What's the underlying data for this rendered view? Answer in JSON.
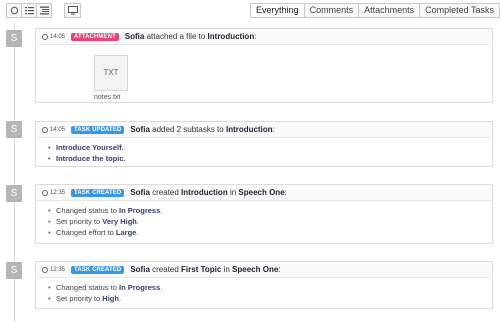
{
  "toolbar": {
    "icons": [
      "circle-view-icon",
      "list-view-icon",
      "detail-view-icon",
      "monitor-icon"
    ]
  },
  "tabs": [
    {
      "label": "Everything",
      "active": true
    },
    {
      "label": "Comments",
      "active": false
    },
    {
      "label": "Attachments",
      "active": false
    },
    {
      "label": "Completed Tasks",
      "active": false
    }
  ],
  "entries": [
    {
      "avatar": "S",
      "time": "14:05",
      "badge": "ATTACHMENT",
      "user": "Sofia",
      "action": "attached a file to",
      "target": "Introduction",
      "suffix": ":",
      "file": {
        "type": "TXT",
        "name": "notes.txt"
      }
    },
    {
      "avatar": "S",
      "time": "14:05",
      "badge": "TASK UPDATED",
      "user": "Sofia",
      "action": "added 2 subtasks to",
      "target": "Introduction",
      "suffix": ":",
      "items": [
        "Introduce Yourself.",
        "Introduce the topic."
      ]
    },
    {
      "avatar": "S",
      "time": "12:35",
      "badge": "TASK CREATED",
      "user": "Sofia",
      "action": "created",
      "target": "Introduction",
      "in": "in",
      "project": "Speech One",
      "suffix": ":",
      "changes": [
        {
          "pre": "Changed status to",
          "value": "In Progress"
        },
        {
          "pre": "Set priority to",
          "value": "Very High"
        },
        {
          "pre": "Changed effort to",
          "value": "Large"
        }
      ]
    },
    {
      "avatar": "S",
      "time": "12:35",
      "badge": "TASK CREATED",
      "user": "Sofia",
      "action": "created",
      "target": "First Topic",
      "in": "in",
      "project": "Speech One",
      "suffix": ":",
      "changes": [
        {
          "pre": "Changed status to",
          "value": "In Progress"
        },
        {
          "pre": "Set priority to",
          "value": "High"
        }
      ]
    }
  ],
  "colors": {
    "attachment_badge": "#e0457b",
    "task_badge": "#3a97e0",
    "avatar": "#b5b5b5"
  }
}
